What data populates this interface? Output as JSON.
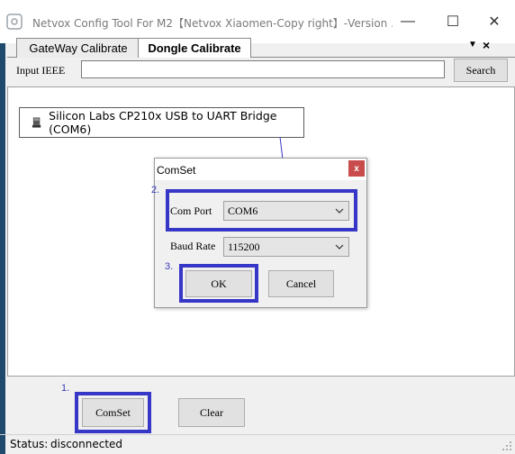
{
  "window": {
    "title": "Netvox Config Tool For M2【Netvox Xiaomen-Copy right】-Version ...",
    "minimize_glyph": "—",
    "maximize_glyph": "☐",
    "close_glyph": "✕"
  },
  "tabs": [
    {
      "label": "GateWay Calibrate",
      "active": false
    },
    {
      "label": "Dongle Calibrate",
      "active": true
    }
  ],
  "tab_controls": {
    "dropdown_glyph": "▼",
    "close_glyph": "×"
  },
  "search_row": {
    "label": "Input IEEE",
    "input_value": "",
    "button_label": "Search"
  },
  "device_list": [
    {
      "label": "Silicon Labs CP210x USB to UART Bridge (COM6)",
      "icon": "usb-device-icon"
    }
  ],
  "comset_dialog": {
    "title": "ComSet",
    "close_glyph": "x",
    "com_port_label": "Com Port",
    "com_port_value": "COM6",
    "baud_rate_label": "Baud Rate",
    "baud_rate_value": "115200",
    "ok_label": "OK",
    "cancel_label": "Cancel"
  },
  "steps": {
    "step1": "1.",
    "step2": "2.",
    "step3": "3."
  },
  "bottom_buttons": {
    "comset_label": "ComSet",
    "clear_label": "Clear"
  },
  "status": {
    "label": "Status:",
    "value": "disconnected"
  },
  "colors": {
    "highlight": "#3636c7",
    "step_text": "#3a3ac0",
    "dialog_close_bg": "#c94c4c"
  }
}
